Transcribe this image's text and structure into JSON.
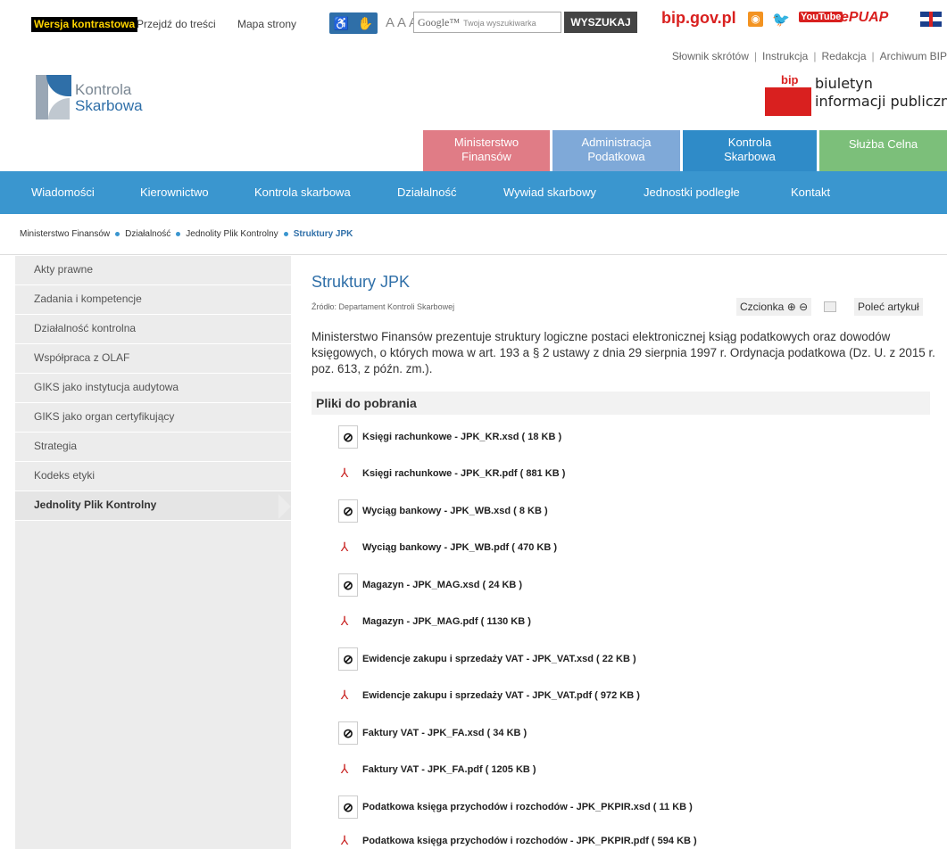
{
  "topbar": {
    "contrast_label": "Wersja kontrastowa",
    "skip_label": "Przejdź do treści",
    "sitemap_label": "Mapa strony",
    "font_sizes": "AAA",
    "search_placeholder": "Twoja wyszukiwarka",
    "search_brand": "Google™",
    "search_button": "WYSZUKAJ",
    "bip_link": "bip.gov.pl",
    "youtube_label": "YouTube",
    "epuap_label": "ePUAP"
  },
  "header": {
    "util_links": [
      "Słownik skrótów",
      "Instrukcja",
      "Redakcja",
      "Archiwum BIP"
    ],
    "logo_line1": "Kontrola",
    "logo_line2": "Skarbowa",
    "bip_word": "bip",
    "bip_line1": "biuletyn",
    "bip_line2": "informacji publicznej",
    "tabs": [
      {
        "line1": "Ministerstwo",
        "line2": "Finansów"
      },
      {
        "line1": "Administracja",
        "line2": "Podatkowa"
      },
      {
        "line1": "Kontrola",
        "line2": "Skarbowa"
      },
      {
        "line1": "Służba Celna",
        "line2": ""
      }
    ]
  },
  "nav": [
    "Wiadomości",
    "Kierownictwo",
    "Kontrola skarbowa",
    "Działalność",
    "Wywiad skarbowy",
    "Jednostki podległe",
    "Kontakt"
  ],
  "breadcrumb": [
    "Ministerstwo Finansów",
    "Działalność",
    "Jednolity Plik Kontrolny",
    "Struktury JPK"
  ],
  "sidebar": [
    "Akty prawne",
    "Zadania i kompetencje",
    "Działalność kontrolna",
    "Współpraca z OLAF",
    "GIKS jako instytucja audytowa",
    "GIKS jako organ certyfikujący",
    "Strategia",
    "Kodeks etyki",
    "Jednolity Plik Kontrolny"
  ],
  "main": {
    "title": "Struktury JPK",
    "source": "Źródło: Departament Kontroli Skarbowej",
    "font_label": "Czcionka ⊕ ⊖",
    "recommend_label": "Poleć artykuł",
    "intro": "Ministerstwo Finansów prezentuje struktury logiczne postaci elektronicznej ksiąg podatkowych oraz dowodów księgowych, o których mowa w art. 193 a § 2 ustawy z dnia 29 sierpnia 1997 r. Ordynacja podatkowa (Dz. U. z 2015 r. poz. 613, z późn. zm.).",
    "downloads_heading": "Pliki do pobrania",
    "files": [
      {
        "type": "xsd",
        "label": "Księgi rachunkowe - JPK_KR.xsd ( 18 KB )"
      },
      {
        "type": "pdf",
        "label": "Księgi rachunkowe - JPK_KR.pdf ( 881 KB )"
      },
      {
        "type": "xsd",
        "label": "Wyciąg bankowy - JPK_WB.xsd ( 8 KB )"
      },
      {
        "type": "pdf",
        "label": "Wyciąg bankowy - JPK_WB.pdf ( 470 KB )"
      },
      {
        "type": "xsd",
        "label": "Magazyn - JPK_MAG.xsd ( 24 KB )"
      },
      {
        "type": "pdf",
        "label": "Magazyn - JPK_MAG.pdf ( 1130 KB )"
      },
      {
        "type": "xsd",
        "label": "Ewidencje zakupu i sprzedaży VAT - JPK_VAT.xsd ( 22 KB )"
      },
      {
        "type": "pdf",
        "label": "Ewidencje zakupu i sprzedaży VAT - JPK_VAT.pdf ( 972 KB )"
      },
      {
        "type": "xsd",
        "label": "Faktury VAT - JPK_FA.xsd ( 34 KB )"
      },
      {
        "type": "pdf",
        "label": "Faktury VAT - JPK_FA.pdf ( 1205 KB )"
      },
      {
        "type": "xsd",
        "label": "Podatkowa księga przychodów i rozchodów - JPK_PKPIR.xsd ( 11 KB )"
      },
      {
        "type": "pdf",
        "label": "Podatkowa księga przychodów i rozchodów - JPK_PKPIR.pdf ( 594 KB )"
      }
    ]
  },
  "colors": {
    "nav_blue": "#3a96cf",
    "title_blue": "#2f6fa8",
    "tab_mf": "#e07c86",
    "tab_ap": "#7fa9d8",
    "tab_ks": "#2f8bc8",
    "tab_sc": "#7cbf7a"
  }
}
